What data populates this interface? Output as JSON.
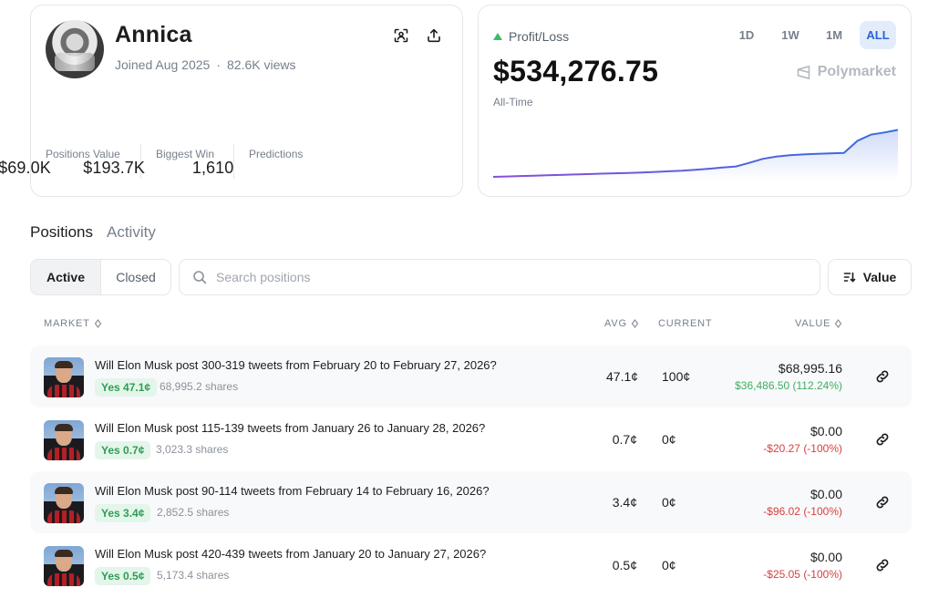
{
  "profile": {
    "name": "Annica",
    "joined": "Joined Aug 2025",
    "views": "82.6K views",
    "stats": [
      {
        "value": "$69.0K",
        "label": "Positions Value"
      },
      {
        "value": "$193.7K",
        "label": "Biggest Win"
      },
      {
        "value": "1,610",
        "label": "Predictions"
      }
    ]
  },
  "pnl": {
    "label": "Profit/Loss",
    "value": "$534,276.75",
    "period": "All-Time",
    "ranges": [
      "1D",
      "1W",
      "1M",
      "ALL"
    ],
    "active_range": "ALL",
    "brand": "Polymarket",
    "colors": {
      "up": "#3fba6a",
      "line_start": "#8a4fd6",
      "line_end": "#2f6fe0"
    }
  },
  "chart_data": {
    "type": "area",
    "x": [
      0,
      1,
      2,
      3,
      4,
      5,
      6,
      7,
      8,
      9,
      10,
      11,
      12,
      13,
      14,
      15,
      16,
      17,
      18,
      19,
      20,
      21,
      22,
      23,
      24,
      25,
      26,
      27,
      28,
      29,
      30
    ],
    "values": [
      0,
      4,
      9,
      13,
      18,
      22,
      27,
      31,
      36,
      40,
      45,
      50,
      56,
      63,
      70,
      80,
      92,
      106,
      118,
      160,
      205,
      230,
      246,
      255,
      262,
      268,
      272,
      410,
      480,
      505,
      534
    ],
    "ylim": [
      0,
      560
    ],
    "grid": false,
    "title": "",
    "xlabel": "",
    "ylabel": ""
  },
  "tabs": [
    "Positions",
    "Activity"
  ],
  "filters": {
    "active": "Active",
    "closed": "Closed"
  },
  "search": {
    "placeholder": "Search positions",
    "value": ""
  },
  "sort": {
    "label": "Value"
  },
  "table": {
    "headers": {
      "market": "MARKET",
      "avg": "AVG",
      "current": "CURRENT",
      "value": "VALUE"
    },
    "rows": [
      {
        "title": "Will Elon Musk post 300-319 tweets from February 20 to February 27, 2026?",
        "outcome": "Yes 47.1¢",
        "shares": "68,995.2 shares",
        "avg": "47.1¢",
        "current": "100¢",
        "value": "$68,995.16",
        "change": "$36,486.50 (112.24%)",
        "trend": "pos"
      },
      {
        "title": "Will Elon Musk post 115-139 tweets from January 26 to January 28, 2026?",
        "outcome": "Yes 0.7¢",
        "shares": "3,023.3 shares",
        "avg": "0.7¢",
        "current": "0¢",
        "value": "$0.00",
        "change": "-$20.27 (-100%)",
        "trend": "neg"
      },
      {
        "title": "Will Elon Musk post 90-114 tweets from February 14 to February 16, 2026?",
        "outcome": "Yes 3.4¢",
        "shares": "2,852.5 shares",
        "avg": "3.4¢",
        "current": "0¢",
        "value": "$0.00",
        "change": "-$96.02 (-100%)",
        "trend": "neg"
      },
      {
        "title": "Will Elon Musk post 420-439 tweets from January 20 to January 27, 2026?",
        "outcome": "Yes 0.5¢",
        "shares": "5,173.4 shares",
        "avg": "0.5¢",
        "current": "0¢",
        "value": "$0.00",
        "change": "-$25.05 (-100%)",
        "trend": "neg"
      }
    ]
  }
}
